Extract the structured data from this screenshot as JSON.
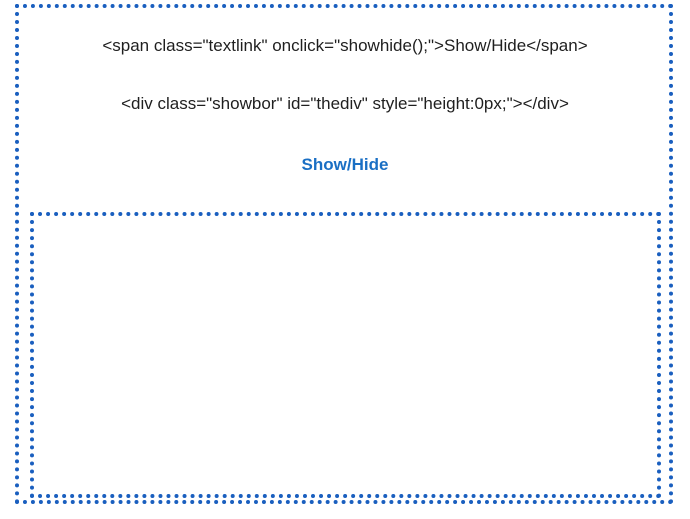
{
  "code": {
    "line1": "<span class=\"textlink\" onclick=\"showhide();\">Show/Hide</span>",
    "line2": "<div class=\"showbor\" id=\"thediv\" style=\"height:0px;\"></div>"
  },
  "toggle_link": {
    "label": "Show/Hide"
  },
  "colors": {
    "border": "#1a5fbf",
    "link": "#1a6fc4",
    "text": "#1f1f1f"
  }
}
